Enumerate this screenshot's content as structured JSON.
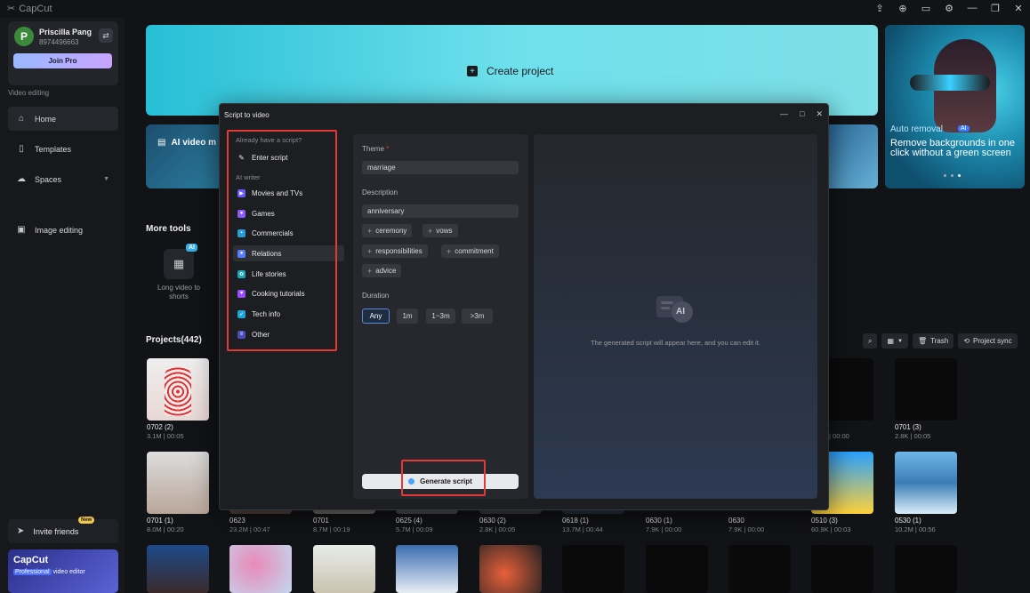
{
  "app": {
    "name": "CapCut"
  },
  "window_icons": [
    "share-icon",
    "upload-icon",
    "feedback-icon",
    "settings-icon",
    "minimize-icon",
    "restore-icon",
    "close-icon"
  ],
  "user": {
    "initial": "P",
    "name": "Priscilla Pang",
    "phone": "8974496663",
    "join_label": "Join Pro"
  },
  "sidebar": {
    "section_label": "Video editing",
    "items": [
      {
        "label": "Home",
        "icon": "home-icon"
      },
      {
        "label": "Templates",
        "icon": "templates-icon"
      },
      {
        "label": "Spaces",
        "icon": "cloud-icon"
      },
      {
        "label": "Image editing",
        "icon": "image-icon"
      }
    ],
    "invite_label": "Invite friends",
    "invite_badge": "New",
    "promo_title": "CapCut",
    "promo_prefix": "Professional",
    "promo_suffix": "video editor"
  },
  "main": {
    "create_label": "Create project",
    "ai_video_label": "AI video m",
    "promo": {
      "line1": "Auto removal",
      "badge": "AI",
      "line2": "Remove backgrounds in one click without a green screen"
    },
    "more_tools": "More tools",
    "tool": {
      "label": "Long video to shorts",
      "badge": "AI"
    },
    "projects_title": "Projects(442)",
    "trash_label": "Trash",
    "sync_label": "Project sync"
  },
  "projects_row1": [
    {
      "name": "0702 (2)",
      "meta": "3.1M | 00:05"
    },
    {
      "name": "",
      "meta": "| 00:00"
    },
    {
      "name": "0701 (3)",
      "meta": "2.8K | 00:05"
    }
  ],
  "projects_row2": [
    {
      "name": "0701 (1)",
      "meta": "8.0M | 00:20"
    },
    {
      "name": "0623",
      "meta": "23.2M | 00:47"
    },
    {
      "name": "0701",
      "meta": "8.7M | 00:19"
    },
    {
      "name": "0625 (4)",
      "meta": "5.7M | 00:09"
    },
    {
      "name": "0630 (2)",
      "meta": "2.8K | 00:05"
    },
    {
      "name": "0618 (1)",
      "meta": "13.7M | 00:44"
    },
    {
      "name": "0630 (1)",
      "meta": "7.9K | 00:00"
    },
    {
      "name": "0630",
      "meta": "7.9K | 00:00"
    },
    {
      "name": "0510 (3)",
      "meta": "60.9K | 00:03"
    },
    {
      "name": "0530 (1)",
      "meta": "10.2M | 00:56"
    }
  ],
  "modal": {
    "title": "Script to video",
    "have_script": "Already have a script?",
    "enter_script": "Enter script",
    "ai_writer": "AI writer",
    "categories": [
      "Movies and TVs",
      "Games",
      "Commercials",
      "Relations",
      "Life stories",
      "Cooking tutorials",
      "Tech info",
      "Other"
    ],
    "theme_label": "Theme",
    "theme_value": "marriage",
    "description_label": "Description",
    "description_value": "anniversary",
    "chips": [
      "ceremony",
      "vows",
      "responsibilities",
      "commitment",
      "advice"
    ],
    "duration_label": "Duration",
    "durations": [
      "Any",
      "1m",
      "1~3m",
      ">3m"
    ],
    "generate_label": "Generate script",
    "output_placeholder": "The generated script will appear here, and you can edit it.",
    "ai_doc_label": "AI"
  }
}
